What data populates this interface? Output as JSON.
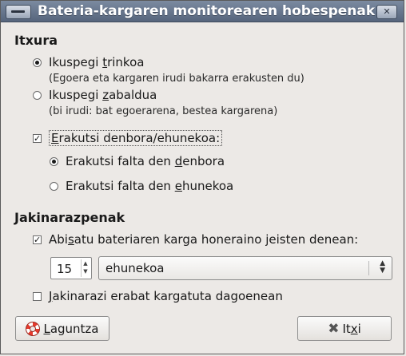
{
  "window": {
    "title": "Bateria-kargaren monitorearen hobespenak"
  },
  "appearance": {
    "heading": "Itxura",
    "compact": {
      "label_pre": "Ikuspegi ",
      "label_ul": "t",
      "label_post": "rinkoa",
      "hint": "(Egoera eta kargaren irudi bakarra erakusten du)",
      "selected": true
    },
    "expanded": {
      "label_pre": "Ikuspegi ",
      "label_ul": "z",
      "label_post": "abaldua",
      "hint": "(bi irudi: bat egoerarena, bestea kargarena)",
      "selected": false
    },
    "show_time": {
      "label_ul": "E",
      "label_post": "rakutsi denbora/ehunekoa:",
      "checked": true
    },
    "time_remaining": {
      "label_pre": "Erakutsi falta den ",
      "label_ul": "d",
      "label_post": "enbora",
      "selected": true
    },
    "percent_remaining": {
      "label_pre": "Erakutsi falta den ",
      "label_ul": "e",
      "label_post": "hunekoa",
      "selected": false
    }
  },
  "notifications": {
    "heading": "Jakinarazpenak",
    "warn": {
      "label_pre": "Abi",
      "label_ul": "s",
      "label_post": "atu bateriaren karga honeraino jeisten denean:",
      "checked": true
    },
    "threshold_value": "15",
    "unit_selected": "ehunekoa",
    "full": {
      "label_ul": "J",
      "label_post": "akinarazi erabat kargatuta dagoenean",
      "checked": false
    }
  },
  "buttons": {
    "help": {
      "label_ul": "L",
      "label_post": "aguntza"
    },
    "close": {
      "label_pre": "It",
      "label_ul": "x",
      "label_post": "i"
    }
  },
  "icons": {
    "menu": "window-menu-icon",
    "close": "window-close-icon",
    "help": "lifebuoy-icon",
    "close_btn": "x-icon"
  }
}
